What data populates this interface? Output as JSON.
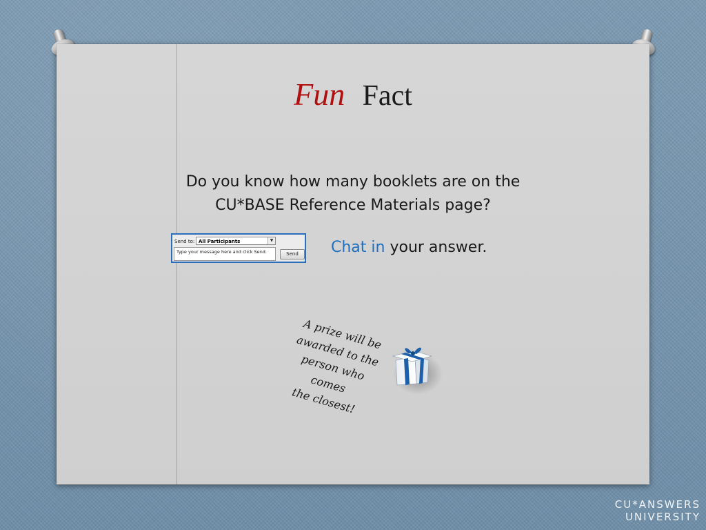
{
  "title": {
    "fun": "Fun",
    "fact": "Fact"
  },
  "question": {
    "line1": "Do you know how many booklets are on the",
    "line2": "CU*BASE Reference Materials page?"
  },
  "chat_widget": {
    "send_to_label": "Send to:",
    "send_to_value": "All Participants",
    "message_placeholder": "Type your message here and click Send.",
    "send_button": "Send"
  },
  "chat_prompt": {
    "highlight": "Chat in",
    "rest": " your answer."
  },
  "prize": {
    "line1": "A prize will be",
    "line2": "awarded to the",
    "line3": "person who comes",
    "line4": "the closest!"
  },
  "branding": {
    "line1": "CU*ANSWERS",
    "line2": "UNIVERSITY"
  },
  "colors": {
    "fun_red": "#b01010",
    "chat_blue": "#1f6fc0",
    "widget_border": "#2a6db8"
  }
}
